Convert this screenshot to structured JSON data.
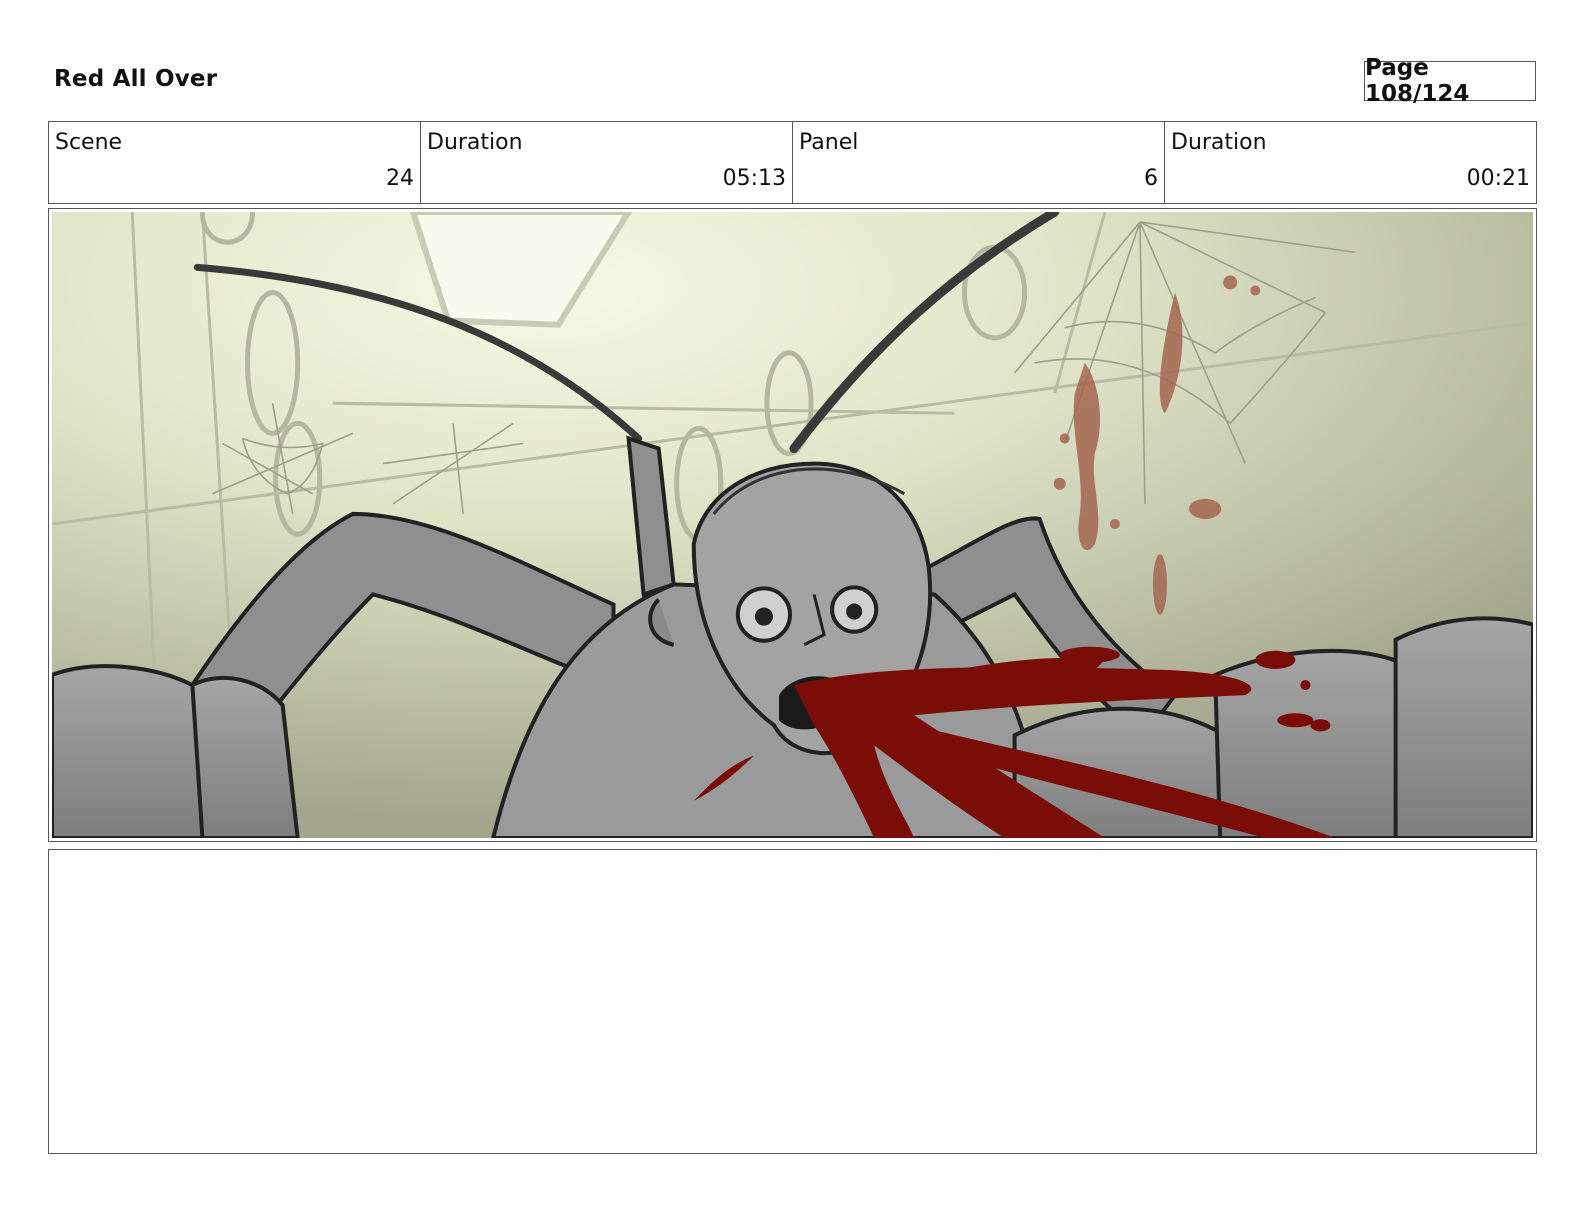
{
  "header": {
    "title": "Red All Over",
    "page": "Page 108/124"
  },
  "info": [
    {
      "label": "Scene",
      "value": "24"
    },
    {
      "label": "Duration",
      "value": "05:13"
    },
    {
      "label": "Panel",
      "value": "6"
    },
    {
      "label": "Duration",
      "value": "00:21"
    }
  ],
  "panel": {
    "image": "storyboard-sketch-creature-spitting-blood",
    "colors": {
      "blood": "#7a0d08",
      "wall_light": "#eef2d8",
      "wall_dark": "#a7aa8e",
      "figure": "#8a8a8a"
    }
  },
  "notes": {
    "text": ""
  }
}
